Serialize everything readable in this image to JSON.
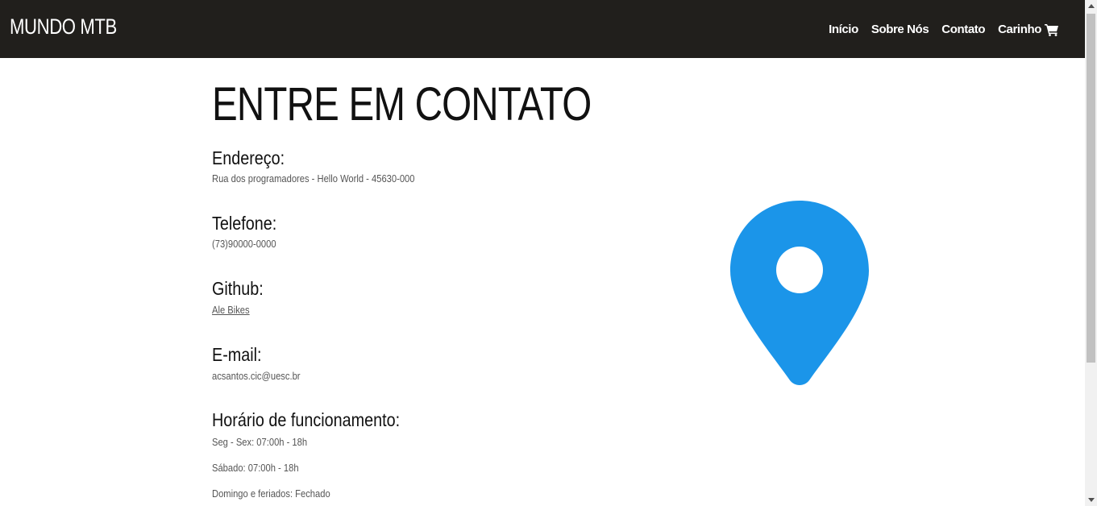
{
  "navbar": {
    "brand": "MUNDO MTB",
    "links": [
      {
        "label": "Início"
      },
      {
        "label": "Sobre Nós"
      },
      {
        "label": "Contato"
      },
      {
        "label": "Carinho"
      }
    ]
  },
  "page": {
    "title": "ENTRE EM CONTATO"
  },
  "contact": {
    "address_heading": "Endereço:",
    "address_value": "Rua dos programadores - Hello World - 45630-000",
    "phone_heading": "Telefone:",
    "phone_value": "(73)90000-0000",
    "github_heading": "Github:",
    "github_link": "Ale Bikes",
    "email_heading": "E-mail:",
    "email_value": "acsantos.cic@uesc.br",
    "hours_heading": "Horário de funcionamento:",
    "hours_weekdays": "Seg - Sex: 07:00h - 18h",
    "hours_saturday": "Sábado: 07:00h - 18h",
    "hours_sunday": "Domingo e feriados: Fechado"
  },
  "icons": {
    "cart": "cart-icon",
    "map_pin": "map-pin-icon"
  },
  "colors": {
    "navbar_bg": "#211f1c",
    "pin": "#1b95e9"
  }
}
